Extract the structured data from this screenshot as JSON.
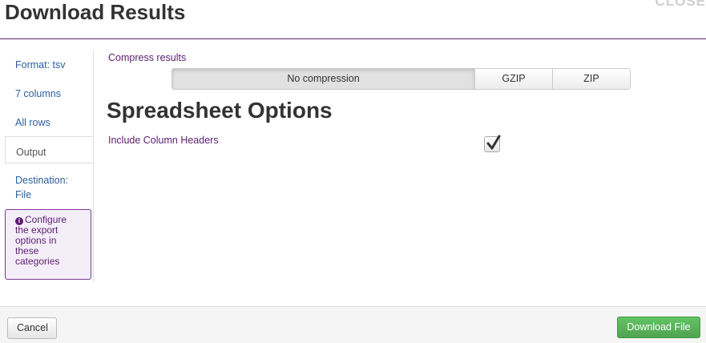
{
  "dialog": {
    "title": "Download Results",
    "close_label": "CLOSE"
  },
  "sidebar": {
    "items": [
      {
        "label": "Format: tsv",
        "active": false
      },
      {
        "label": "7 columns",
        "active": false
      },
      {
        "label": "All rows",
        "active": false
      },
      {
        "label": "Output",
        "active": true
      },
      {
        "label": "Destination: File",
        "active": false
      }
    ],
    "hint": "Configure the export options in these categories",
    "hint_icon": "info-circle-icon"
  },
  "compress": {
    "label": "Compress results",
    "options": [
      "No compression",
      "GZIP",
      "ZIP"
    ],
    "selected": "No compression"
  },
  "spreadsheet": {
    "title": "Spreadsheet Options",
    "include_headers_label": "Include Column Headers",
    "include_headers_checked": true
  },
  "footer": {
    "cancel_label": "Cancel",
    "download_label": "Download File"
  },
  "colors": {
    "accent": "#5a1e6e",
    "link": "#2a5f9e",
    "primary_button": "#51a351"
  }
}
